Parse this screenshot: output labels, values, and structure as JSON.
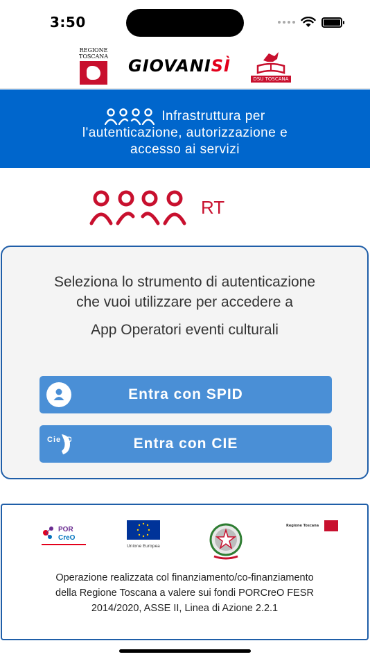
{
  "status_bar": {
    "time": "3:50"
  },
  "header": {
    "regione_logo_text": "REGIONE TOSCANA",
    "giovani_text": "GIOVANI",
    "giovani_si": "SÌ",
    "dsu_text": "DSU TOSCANA"
  },
  "banner": {
    "line1": "Infrastruttura per",
    "line2": "l'autenticazione, autorizzazione e",
    "line3": "accesso ai servizi"
  },
  "arpa": {
    "suffix": "RT"
  },
  "card": {
    "prompt_line1": "Seleziona lo strumento di autenticazione",
    "prompt_line2": "che vuoi utilizzare per accedere a",
    "app_name": "App Operatori eventi culturali",
    "spid_label": "Entra con SPID",
    "cie_label": "Entra con CIE",
    "cie_icon_text": "Cie ID"
  },
  "footer": {
    "porcreo_text": "POR CreO",
    "ue_text": "Unione Europea",
    "rt_small_text": "Regione Toscana",
    "line1": "Operazione realizzata col finanziamento/co-finanziamento",
    "line2": "della Regione Toscana a valere sui fondi PORCreO FESR",
    "line3": "2014/2020, ASSE II, Linea di Azione 2.2.1"
  },
  "colors": {
    "banner_blue": "#0066cc",
    "button_blue": "#4a8fd6",
    "card_border": "#1f5ea8",
    "arpa_red": "#c8102e"
  }
}
